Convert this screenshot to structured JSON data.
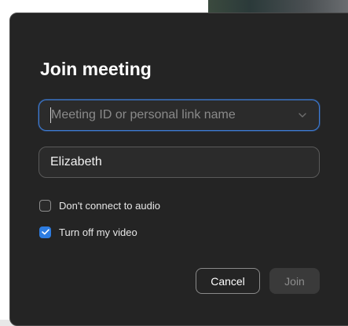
{
  "dialog": {
    "title": "Join meeting"
  },
  "meeting_id_field": {
    "placeholder": "Meeting ID or personal link name",
    "value": ""
  },
  "name_field": {
    "placeholder": "",
    "value": "Elizabeth"
  },
  "options": [
    {
      "label": "Don't connect to audio",
      "checked": false
    },
    {
      "label": "Turn off my video",
      "checked": true
    }
  ],
  "buttons": {
    "cancel_label": "Cancel",
    "join_label": "Join"
  },
  "colors": {
    "dialog_bg": "#242424",
    "accent": "#2d7ce0",
    "focus_border": "#3d7cd6",
    "disabled_button_bg": "#3a3a3a"
  },
  "icons": {
    "meeting_id_dropdown": "chevron-down-icon",
    "video_checkbox_mark": "checkmark-icon"
  }
}
